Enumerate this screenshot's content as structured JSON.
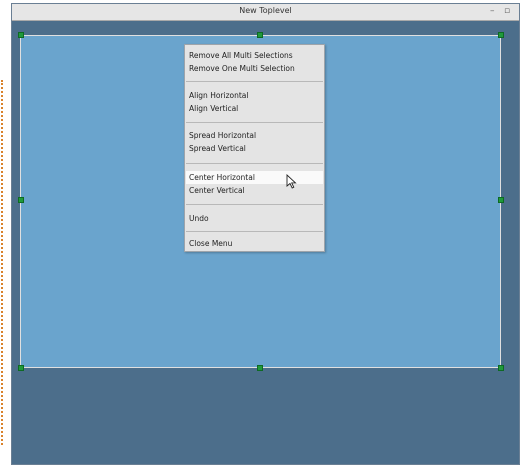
{
  "window": {
    "title": "New Toplevel",
    "buttons": {
      "minimize": "–",
      "maximize": "▫"
    }
  },
  "context_menu": {
    "items": [
      {
        "label": "Remove All Multi Selections"
      },
      {
        "label": "Remove One Multi Selection"
      },
      {
        "label": "Align Horizontal"
      },
      {
        "label": "Align Vertical"
      },
      {
        "label": "Spread Horizontal"
      },
      {
        "label": "Spread Vertical"
      },
      {
        "label": "Center Horizontal",
        "highlighted": true
      },
      {
        "label": "Center Vertical"
      },
      {
        "label": "Undo"
      },
      {
        "label": "Close Menu"
      }
    ]
  },
  "colors": {
    "window_background": "#4c6e8b",
    "canvas_background": "#6aa4cd",
    "selection_handle": "#1f9a3a",
    "menu_background": "#e4e4e4"
  },
  "icons": [
    "minimize-icon",
    "maximize-icon",
    "mouse-pointer-icon"
  ]
}
